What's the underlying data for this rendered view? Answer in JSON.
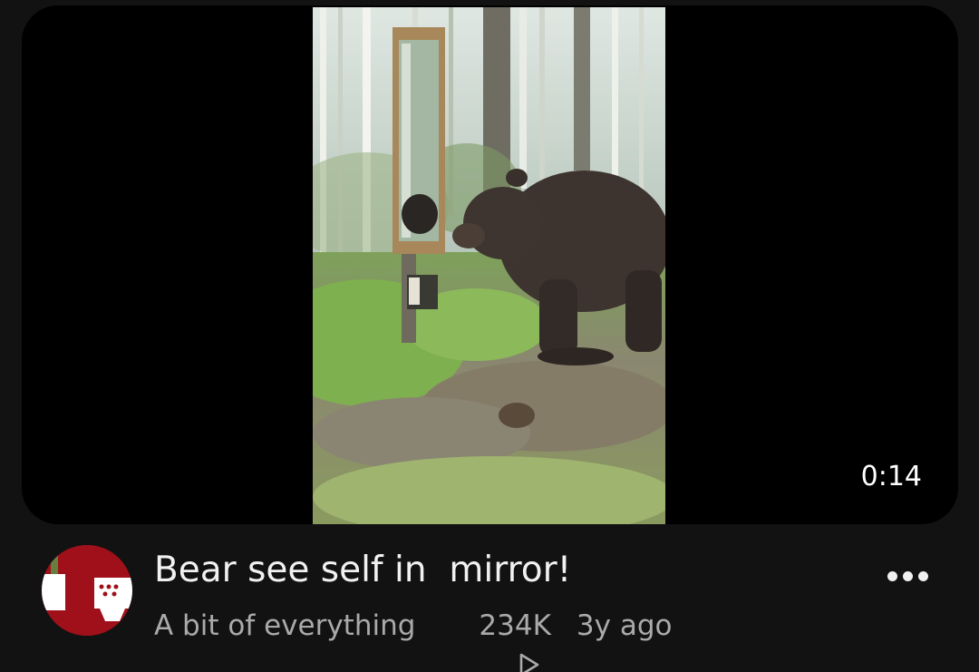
{
  "video": {
    "duration": "0:14",
    "thumbnail_icon": "bear-mirror-thumbnail"
  },
  "info": {
    "title": "Bear see self in  mirror!",
    "channel": "A bit of everything",
    "views": "234K",
    "age": "3y ago",
    "views_icon": "play-outline-icon",
    "more_icon": "more-options-icon"
  },
  "colors": {
    "background": "#121212",
    "title": "#f1f1f1",
    "secondary_text": "#aaaaaa",
    "avatar_red": "#a0101a"
  }
}
